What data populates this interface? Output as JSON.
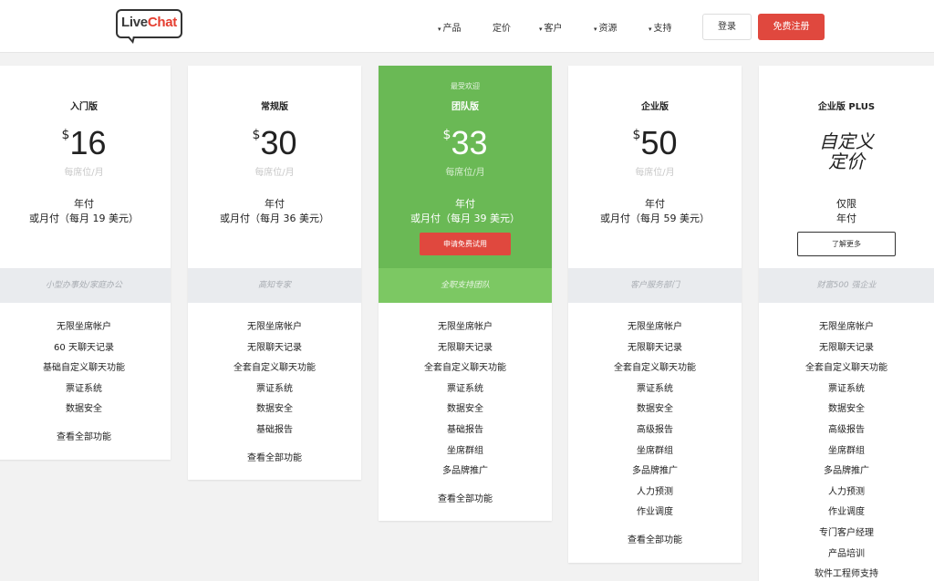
{
  "header": {
    "logo_part1": "Live",
    "logo_part2": "Chat",
    "nav": [
      {
        "label": "产品",
        "has_caret": true
      },
      {
        "label": "定价",
        "has_caret": false
      },
      {
        "label": "客户",
        "has_caret": true
      },
      {
        "label": "资源",
        "has_caret": true
      },
      {
        "label": "支持",
        "has_caret": true
      }
    ],
    "caret": "▾",
    "login": "登录",
    "signup": "免费注册"
  },
  "plans": [
    {
      "name": "入门版",
      "currency": "$",
      "price": "16",
      "per": "每席位/月",
      "billing1": "年付",
      "billing2": "或月付（每月 19 美元）",
      "audience": "小型办事处/家庭办公",
      "features": [
        "无限坐席帐户",
        "60 天聊天记录",
        "基础自定义聊天功能",
        "票证系统",
        "数据安全"
      ],
      "see_all": "查看全部功能"
    },
    {
      "name": "常规版",
      "currency": "$",
      "price": "30",
      "per": "每席位/月",
      "billing1": "年付",
      "billing2": "或月付（每月 36 美元）",
      "audience": "高知专家",
      "features": [
        "无限坐席帐户",
        "无限聊天记录",
        "全套自定义聊天功能",
        "票证系统",
        "数据安全",
        "基础报告"
      ],
      "see_all": "查看全部功能"
    },
    {
      "popular": "最受欢迎",
      "name": "团队版",
      "currency": "$",
      "price": "33",
      "per": "每席位/月",
      "billing1": "年付",
      "billing2": "或月付（每月 39 美元）",
      "cta": "申请免费试用",
      "audience": "全职支持团队",
      "features": [
        "无限坐席帐户",
        "无限聊天记录",
        "全套自定义聊天功能",
        "票证系统",
        "数据安全",
        "基础报告",
        "坐席群组",
        "多品牌推广"
      ],
      "see_all": "查看全部功能"
    },
    {
      "name": "企业版",
      "currency": "$",
      "price": "50",
      "per": "每席位/月",
      "billing1": "年付",
      "billing2": "或月付（每月 59 美元）",
      "audience": "客户服务部门",
      "features": [
        "无限坐席帐户",
        "无限聊天记录",
        "全套自定义聊天功能",
        "票证系统",
        "数据安全",
        "高级报告",
        "坐席群组",
        "多品牌推广",
        "人力预测",
        "作业调度"
      ],
      "see_all": "查看全部功能"
    },
    {
      "name": "企业版 PLUS",
      "custom1": "自定义",
      "custom2": "定价",
      "billing1": "仅限",
      "billing2": "年付",
      "cta": "了解更多",
      "audience": "财富500 强企业",
      "features": [
        "无限坐席帐户",
        "无限聊天记录",
        "全套自定义聊天功能",
        "票证系统",
        "数据安全",
        "高级报告",
        "坐席群组",
        "多品牌推广",
        "人力预测",
        "作业调度",
        "专门客户经理",
        "产品培训",
        "软件工程师支持"
      ]
    }
  ],
  "colors": {
    "accent_red": "#e0483e",
    "featured_green": "#6ab955",
    "band_green": "#7cc863"
  }
}
